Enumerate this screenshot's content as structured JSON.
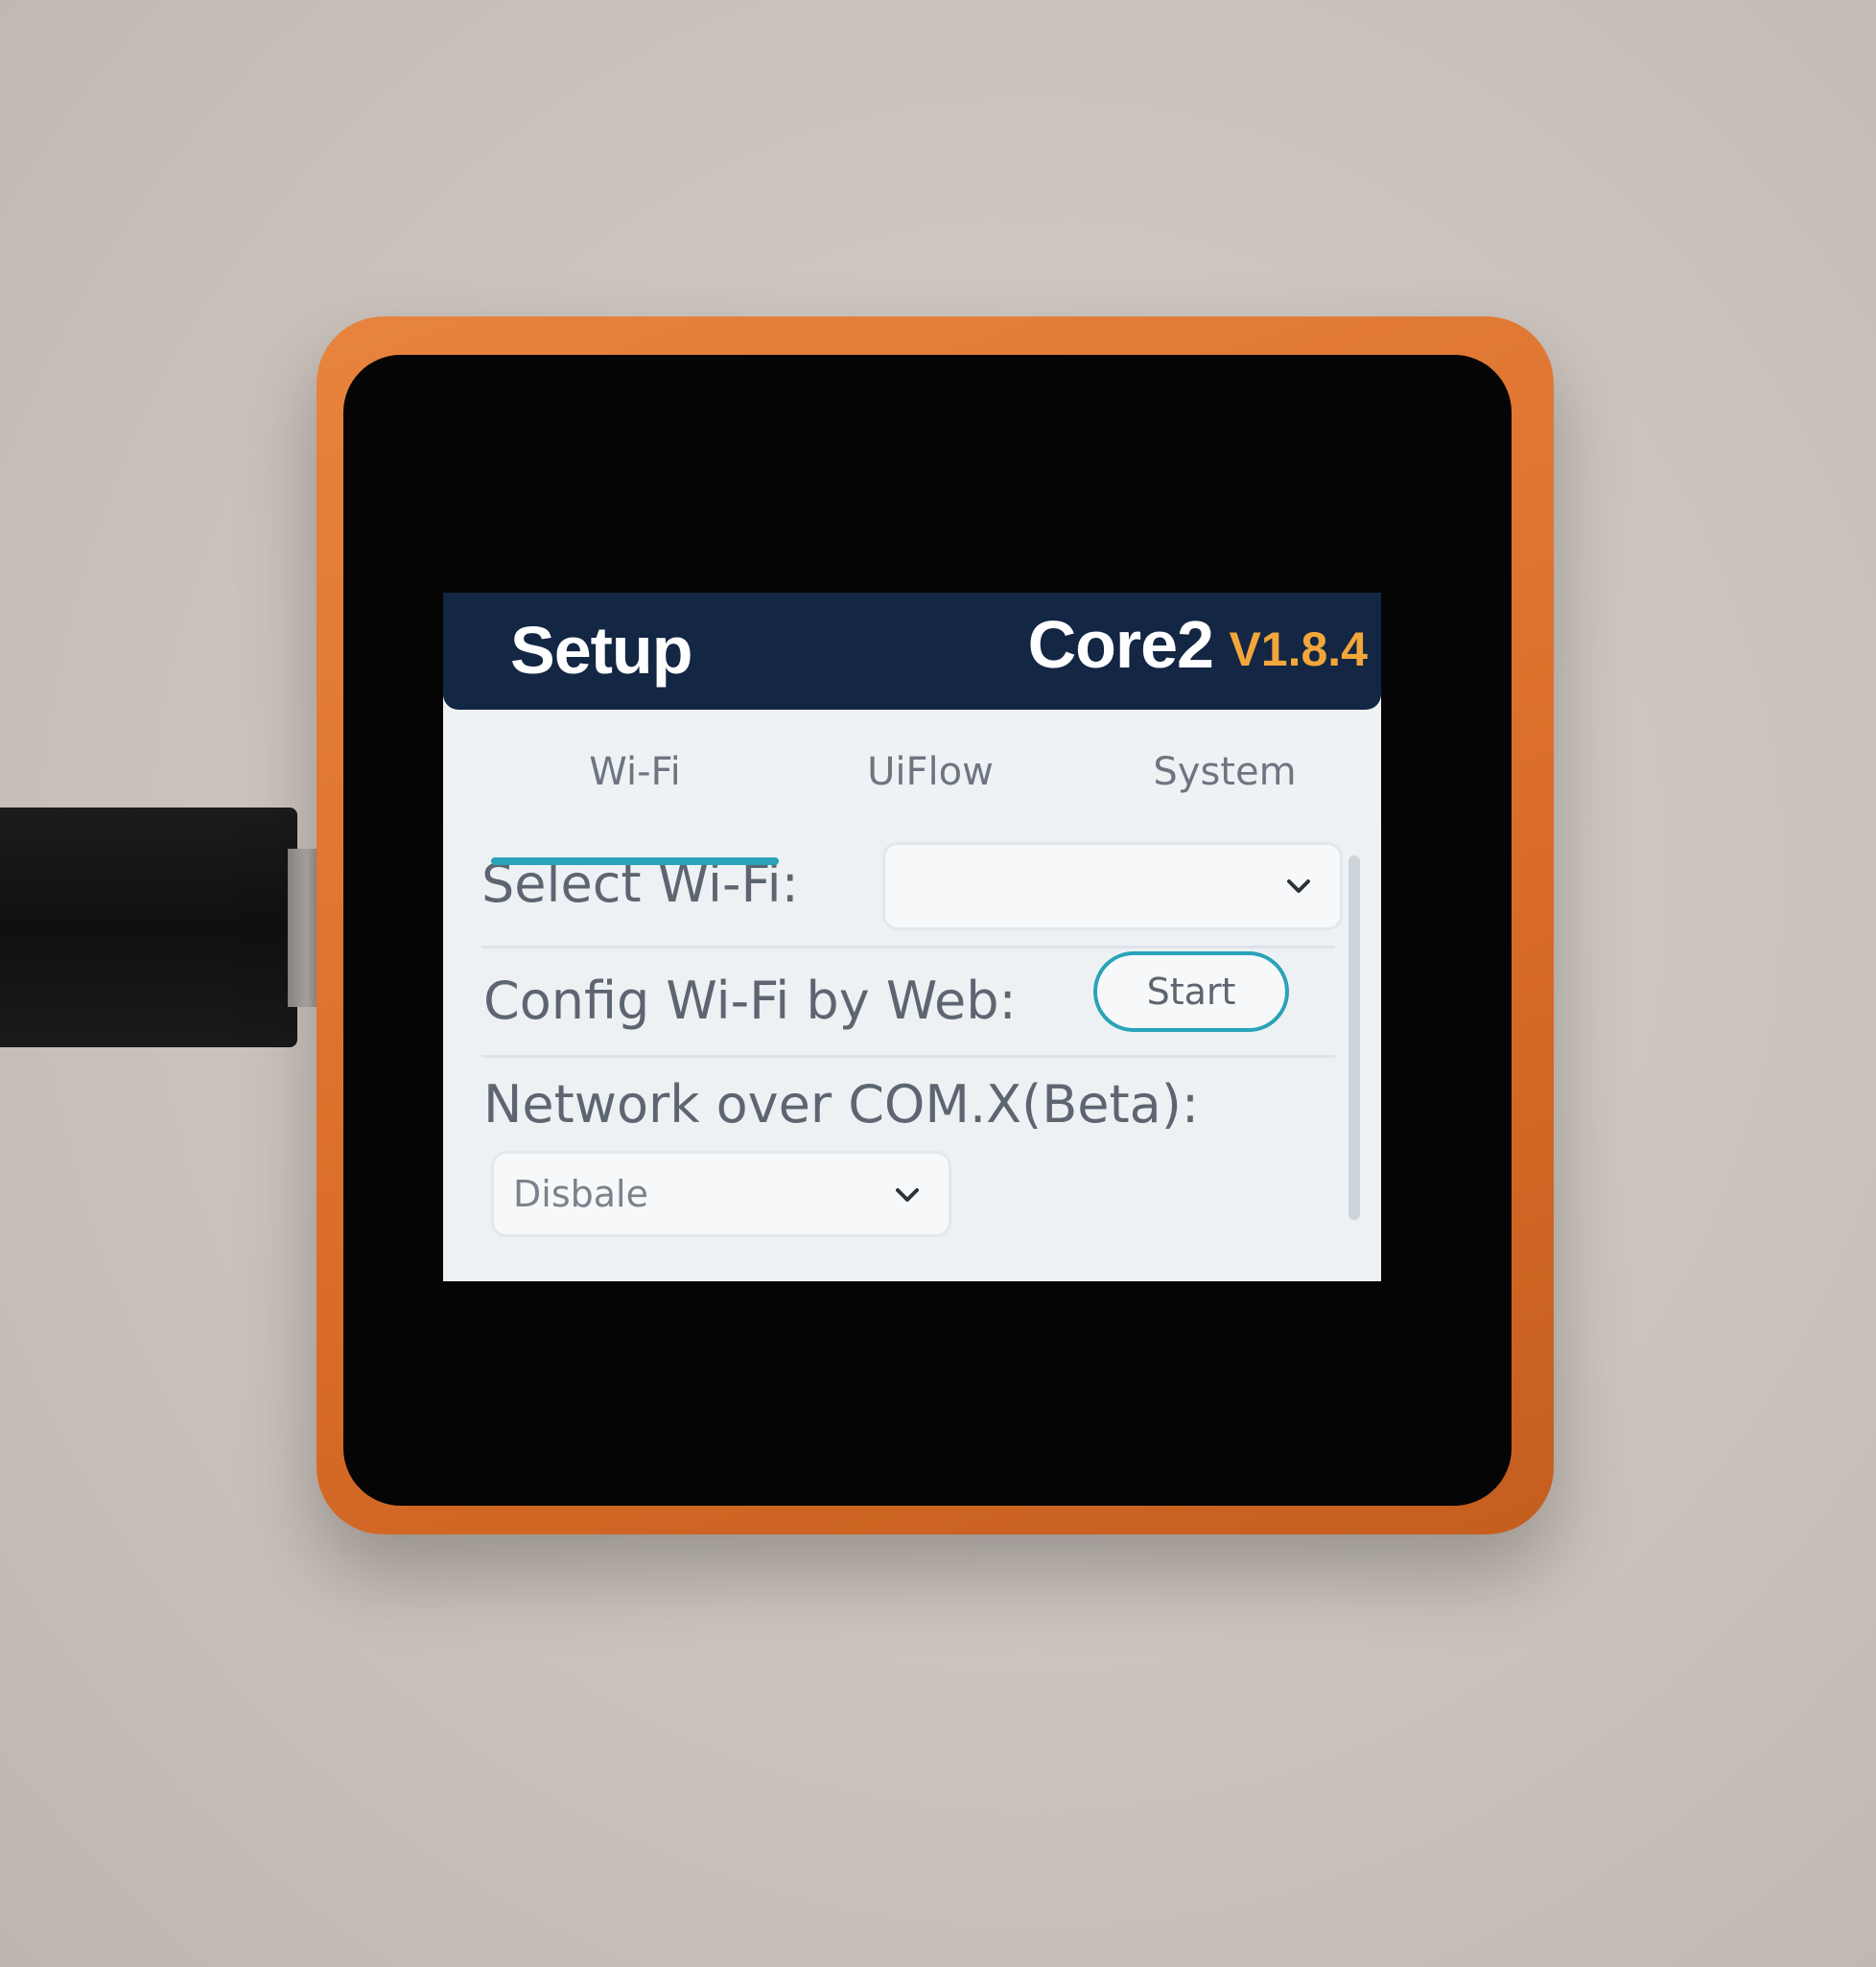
{
  "header": {
    "title": "Setup",
    "model": "Core2",
    "version": "V1.8.4"
  },
  "tabs": [
    {
      "label": "Wi-Fi",
      "selected": true
    },
    {
      "label": "UiFlow",
      "selected": false
    },
    {
      "label": "System",
      "selected": false
    }
  ],
  "wifi": {
    "select_label": "Select Wi-Fi:",
    "select_value": "",
    "config_label": "Config Wi-Fi by Web:",
    "start_label": "Start",
    "network_label": "Network over COM.X(Beta):",
    "network_value": "Disbale"
  },
  "colors": {
    "header_bg": "#132643",
    "version": "#f2a63a",
    "accent": "#2aa3b8",
    "device_shell": "#d96c28"
  },
  "icons": {
    "dropdown": "chevron-down-icon"
  }
}
